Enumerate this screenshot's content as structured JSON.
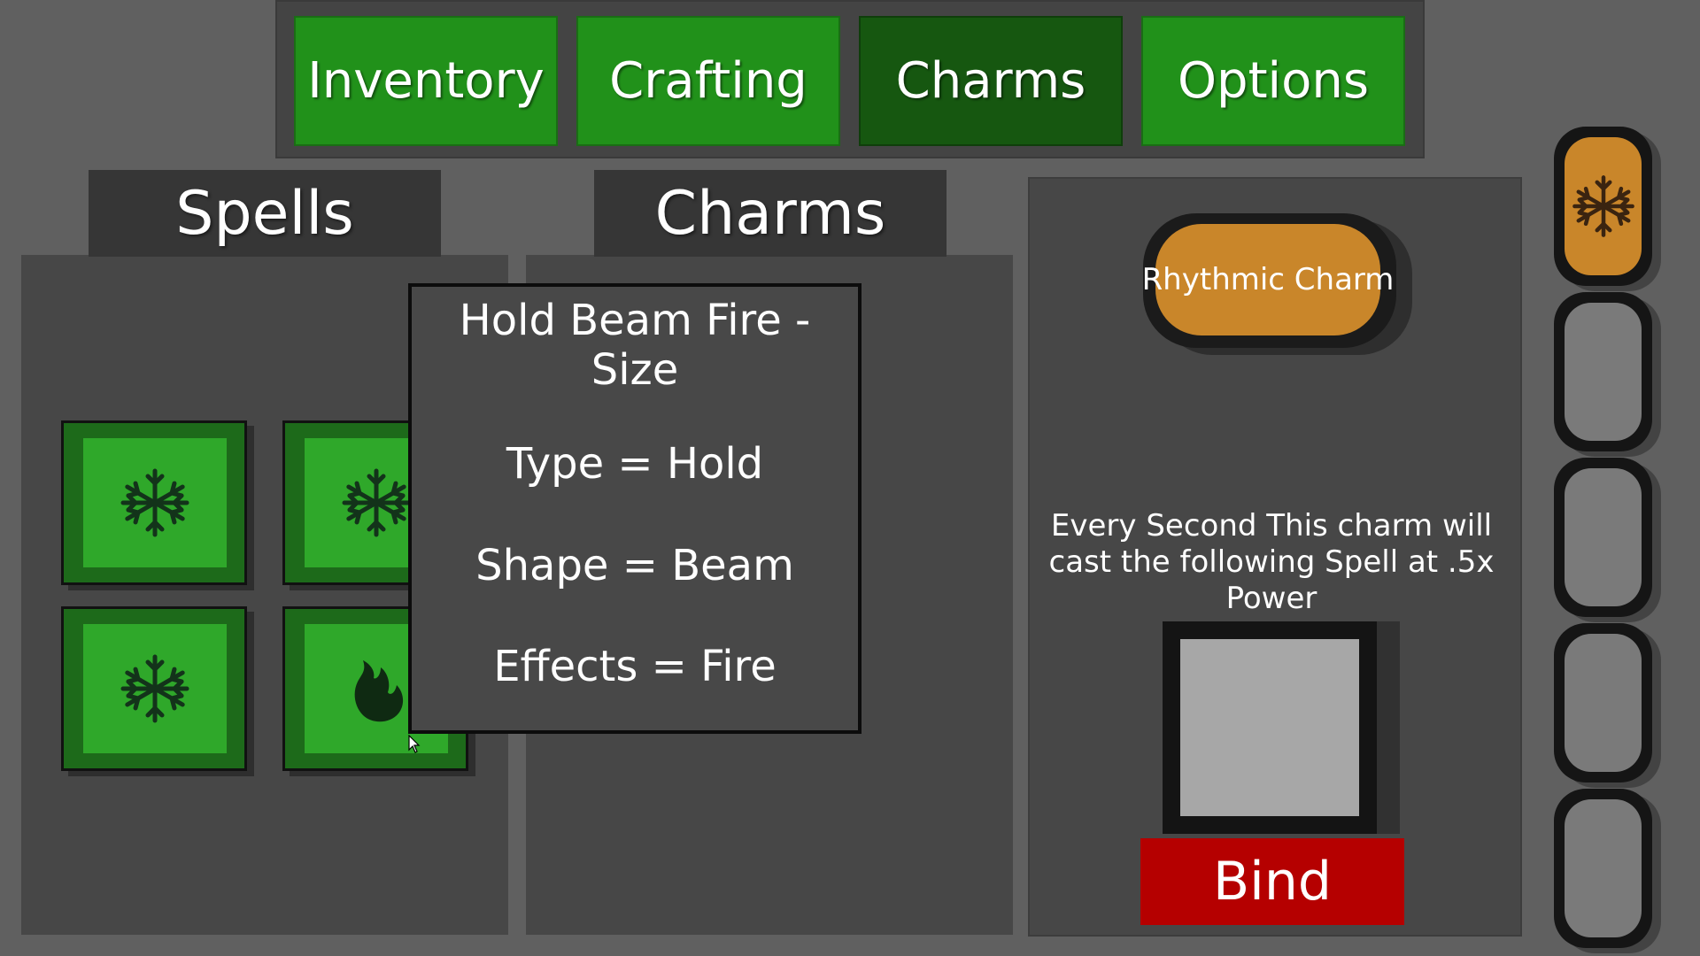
{
  "tabs": [
    {
      "label": "Inventory",
      "active": false
    },
    {
      "label": "Crafting",
      "active": false
    },
    {
      "label": "Charms",
      "active": true
    },
    {
      "label": "Options",
      "active": false
    }
  ],
  "spells_panel": {
    "title": "Spells",
    "slots": [
      {
        "icon": "snowflake-icon"
      },
      {
        "icon": "snowflake-icon"
      },
      {
        "icon": "snowflake-icon"
      },
      {
        "icon": "flame-icon"
      }
    ]
  },
  "charms_panel": {
    "title": "Charms"
  },
  "tooltip": {
    "title": "Hold Beam Fire - Size",
    "type_line": "Type = Hold",
    "shape_line": "Shape = Beam",
    "effects_line": "Effects =  Fire"
  },
  "charm_detail": {
    "name": "Rhythmic Charm",
    "description": "Every Second This charm will cast the following Spell at .5x Power",
    "bind_label": "Bind"
  },
  "charm_slots": [
    {
      "icon": "snowflake-icon",
      "filled": true
    },
    {
      "icon": "",
      "filled": false
    },
    {
      "icon": "",
      "filled": false
    },
    {
      "icon": "",
      "filled": false
    },
    {
      "icon": "",
      "filled": false
    }
  ],
  "colors": {
    "tab_green": "#21911a",
    "tab_active": "#165710",
    "slot_green": "#2fa82a",
    "charm_orange": "#c9862a",
    "bind_red": "#b50000"
  }
}
